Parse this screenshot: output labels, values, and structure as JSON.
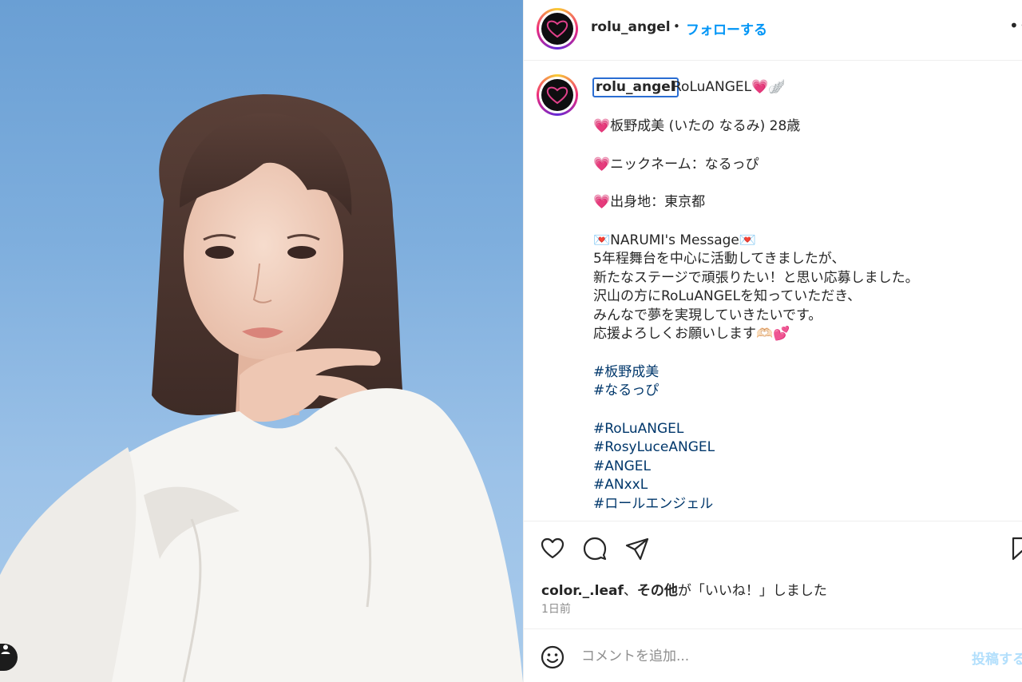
{
  "header": {
    "username": "rolu_angel",
    "separator": "•",
    "follow_label": "フォローする",
    "more_label": "••"
  },
  "caption": {
    "username": "rolu_angel",
    "title": "RoLuANGEL💗🪽",
    "lines": [
      "💗板野成美 (いたの なるみ) 28歳",
      "",
      "💗ニックネーム：なるっぴ",
      "",
      "💗出身地：東京都",
      "",
      "💌NARUMI's Message💌",
      "5年程舞台を中心に活動してきましたが、",
      "新たなステージで頑張りたい！と思い応募しました。",
      "沢山の方にRoLuANGELを知っていただき、",
      "みんなで夢を実現していきたいです。",
      "応援よろしくお願いします🫶🏻💕",
      "",
      "#板野成美",
      "#なるっぴ",
      "",
      "#RoLuANGEL",
      "#RosyLuceANGEL",
      "#ANGEL",
      "#ANxxL",
      "#ロールエンジェル"
    ]
  },
  "likes": {
    "user": "color._.leaf",
    "sep": "、",
    "others": "その他",
    "suffix": "が「いいね！」しました"
  },
  "time_ago": "1日前",
  "comment": {
    "placeholder": "コメントを追加...",
    "post_label": "投稿する"
  },
  "icons": {
    "like": "heart-icon",
    "comment": "comment-icon",
    "share": "send-icon",
    "save": "bookmark-icon",
    "emoji": "smiley-icon",
    "tag": "user-tag-icon"
  }
}
